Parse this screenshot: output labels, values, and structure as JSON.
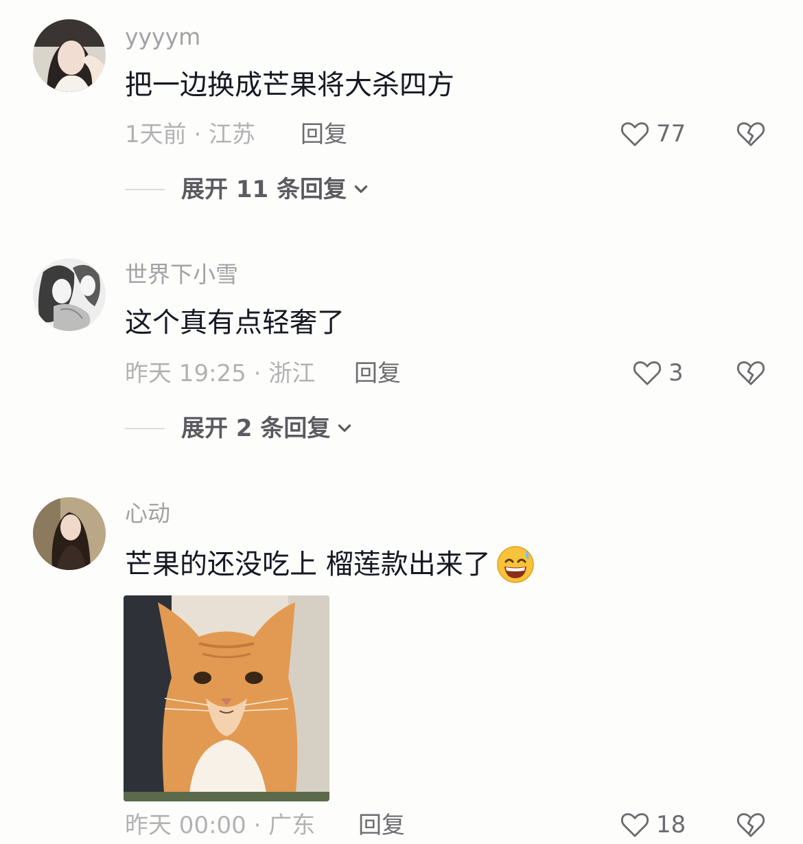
{
  "comments": [
    {
      "username": "yyyym",
      "text": "把一边换成芒果将大杀四方",
      "meta": "1天前 · 江苏",
      "reply_label": "回复",
      "likes": "77",
      "expand_label": "展开 11 条回复",
      "avatar_icon": "avatar-girl-icon"
    },
    {
      "username": "世界下小雪",
      "text": "这个真有点轻奢了",
      "meta": "昨天 19:25 · 浙江",
      "reply_label": "回复",
      "likes": "3",
      "expand_label": "展开 2 条回复",
      "avatar_icon": "avatar-anime-icon"
    },
    {
      "username": "心动",
      "text": "芒果的还没吃上 榴莲款出来了",
      "emoji": "grinning-sweat-emoji-icon",
      "image": "orange-cat-photo",
      "meta": "昨天 00:00 · 广东",
      "reply_label": "回复",
      "likes": "18",
      "avatar_icon": "avatar-girl-icon"
    }
  ],
  "icons": {
    "like": "heart-outline-icon",
    "dislike": "broken-heart-icon",
    "expand": "chevron-down-icon"
  },
  "colors": {
    "background": "#fdfdfb",
    "username": "#a2a2a6",
    "text": "#161823",
    "meta": "#b2b2b5",
    "action": "#6b6b70"
  }
}
